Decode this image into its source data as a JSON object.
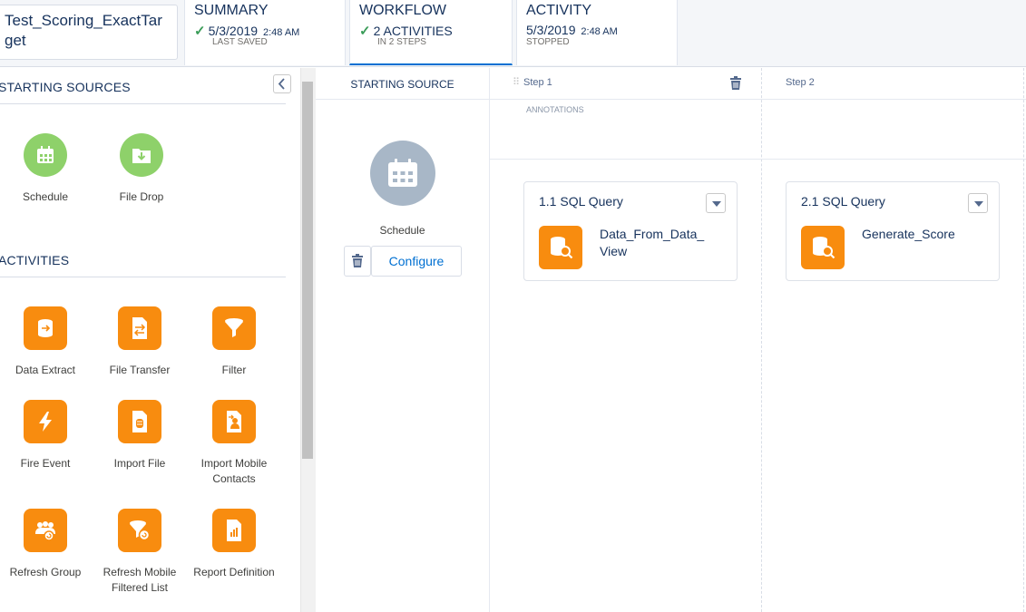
{
  "header": {
    "automation_name": "Test_Scoring_ExactTarget",
    "tabs": [
      {
        "title": "SUMMARY",
        "line1": "5/3/2019",
        "line1_small": "2:48 AM",
        "line2": "LAST SAVED",
        "check": true
      },
      {
        "title": "WORKFLOW",
        "line1": "2 ACTIVITIES",
        "line1_small": "",
        "line2": "IN 2 STEPS",
        "check": true,
        "active": true
      },
      {
        "title": "ACTIVITY",
        "line1": "5/3/2019",
        "line1_small": "2:48 AM",
        "line2": "STOPPED",
        "check": false
      }
    ]
  },
  "sidebar": {
    "starting_sources_title": "STARTING SOURCES",
    "starting_sources": [
      {
        "label": "Schedule",
        "icon": "calendar-icon"
      },
      {
        "label": "File Drop",
        "icon": "folder-download-icon"
      }
    ],
    "activities_title": "ACTIVITIES",
    "activities": [
      {
        "label": "Data Extract",
        "icon": "data-extract-icon"
      },
      {
        "label": "File Transfer",
        "icon": "file-transfer-icon"
      },
      {
        "label": "Filter",
        "icon": "funnel-icon"
      },
      {
        "label": "Fire Event",
        "icon": "lightning-icon"
      },
      {
        "label": "Import File",
        "icon": "import-file-icon"
      },
      {
        "label": "Import Mobile Contacts",
        "icon": "import-contacts-icon"
      },
      {
        "label": "Refresh Group",
        "icon": "refresh-group-icon"
      },
      {
        "label": "Refresh Mobile Filtered List",
        "icon": "refresh-filtered-list-icon"
      },
      {
        "label": "Report Definition",
        "icon": "report-icon"
      }
    ]
  },
  "canvas": {
    "starting_source_header": "STARTING SOURCE",
    "starting_source_label": "Schedule",
    "configure_label": "Configure",
    "annotations_label": "ANNOTATIONS",
    "steps": [
      {
        "label": "Step 1",
        "card_title": "1.1 SQL Query",
        "query_name": "Data_From_Data_View"
      },
      {
        "label": "Step 2",
        "card_title": "2.1 SQL Query",
        "query_name": "Generate_Score"
      }
    ]
  },
  "colors": {
    "activity_orange": "#f88c0f",
    "source_green": "#8ed16a",
    "link_blue": "#0070d2",
    "title_navy": "#16325c"
  }
}
